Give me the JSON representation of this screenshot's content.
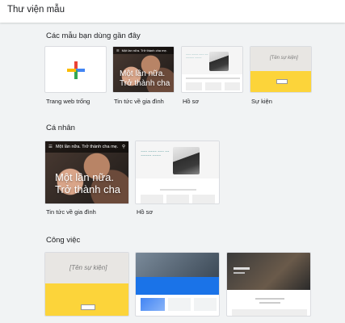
{
  "page_title": "Thư viện mẫu",
  "sections": {
    "recent": {
      "title": "Các mẫu bạn dùng gần đây"
    },
    "personal": {
      "title": "Cá nhân"
    },
    "work": {
      "title": "Công việc"
    }
  },
  "templates": {
    "blank": {
      "label": "Trang web trống"
    },
    "family_news": {
      "label": "Tin tức về gia đình",
      "bar_text": "Một lần nữa. Trở thành cha mẹ.",
      "headline_1": "Một lần nữa.",
      "headline_2": "Trở thành cha"
    },
    "profile": {
      "label": "Hồ sơ"
    },
    "event": {
      "label": "Sự kiện",
      "name_text": "[Tên sự kiện]"
    }
  },
  "colors": {
    "plus_blue": "#4285f4",
    "plus_red": "#ea4335",
    "plus_yellow": "#fbbc04",
    "plus_green": "#34a853",
    "event_yellow": "#fcd43a",
    "work_blue": "#1a73e8"
  },
  "icons": {
    "plus": "plus-icon",
    "menu": "hamburger-menu-icon",
    "search": "search-icon"
  }
}
